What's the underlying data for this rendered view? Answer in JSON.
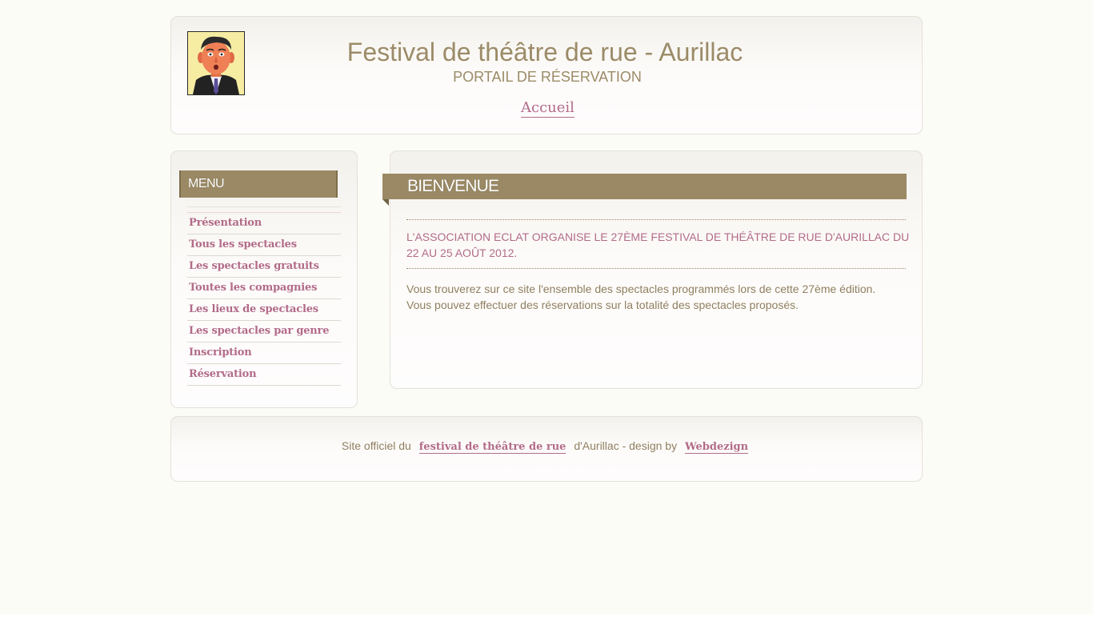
{
  "header": {
    "title": "Festival de théâtre de rue - Aurillac",
    "subtitle": "PORTAIL DE RÉSERVATION",
    "home_link": "Accueil"
  },
  "sidebar": {
    "menu_title": "MENU",
    "items": [
      {
        "label": "Présentation"
      },
      {
        "label": "Tous les spectacles"
      },
      {
        "label": "Les spectacles gratuits"
      },
      {
        "label": "Toutes les compagnies"
      },
      {
        "label": "Les lieux de spectacles"
      },
      {
        "label": "Les spectacles par genre"
      },
      {
        "label": "Inscription"
      },
      {
        "label": "Réservation"
      }
    ]
  },
  "main": {
    "title": "BIENVENUE",
    "intro": "L'ASSOCIATION ECLAT ORGANISE LE 27ÈME FESTIVAL DE THÉÂTRE DE RUE D'AURILLAC DU 22 AU 25 AOÛT 2012.",
    "paragraph_line1": "Vous trouverez sur ce site l'ensemble des spectacles programmés lors de cette 27ème édition.",
    "paragraph_line2": "Vous pouvez effectuer des réservations sur la totalité des spectacles proposés."
  },
  "footer": {
    "prefix": "Site officiel du",
    "festival_link": "festival de théâtre de rue",
    "middle": "d'Aurillac - design by",
    "designer_link": "Webdezign"
  },
  "colors": {
    "accent": "#9a8964",
    "link": "#b26b89",
    "text": "#8f7f60",
    "background": "#fcfcf6"
  },
  "icons": {
    "logo": "caricature-portrait-logo"
  }
}
